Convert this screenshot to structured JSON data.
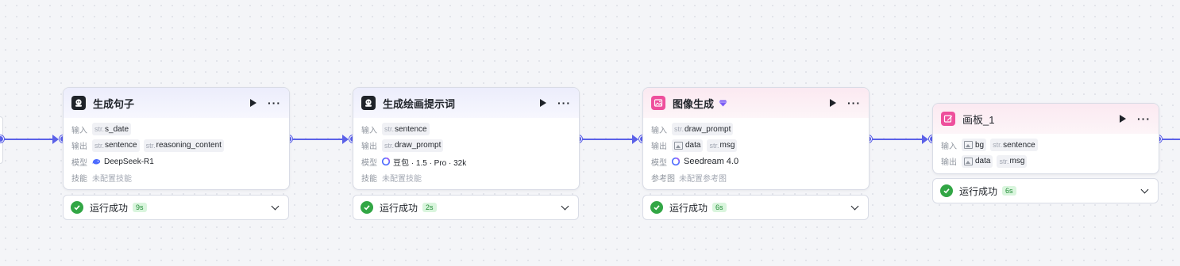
{
  "labels": {
    "input": "输入",
    "output": "输出",
    "model": "模型",
    "skill": "技能",
    "ref_image": "参考图",
    "str_type": "str.",
    "status_success": "运行成功"
  },
  "nodes": [
    {
      "title": "生成句子",
      "inputs": [
        "s_date"
      ],
      "outputs": [
        "sentence",
        "reasoning_content"
      ],
      "model": "DeepSeek-R1",
      "skill": "未配置技能",
      "run_time": "9s"
    },
    {
      "title": "生成绘画提示词",
      "inputs": [
        "sentence"
      ],
      "outputs": [
        "draw_prompt"
      ],
      "model": "豆包 · 1.5 · Pro · 32k",
      "skill": "未配置技能",
      "run_time": "2s"
    },
    {
      "title": "图像生成",
      "inputs": [
        "draw_prompt"
      ],
      "outputs": [
        "data",
        "msg"
      ],
      "model": "Seedream 4.0",
      "ref_image": "未配置参考图",
      "run_time": "6s"
    },
    {
      "title": "画板_1",
      "inputs": [
        "bg",
        "sentence"
      ],
      "outputs": [
        "data",
        "msg"
      ],
      "run_time": "6s"
    }
  ],
  "colors": {
    "edge": "#5b61e8",
    "success": "#32a645",
    "image_node_accent": "#ee4f9c"
  },
  "icons": {
    "llm_node": "robot-icon",
    "image_node": "image-icon",
    "canvas_node": "canvas-pen-icon",
    "run": "play-icon",
    "more": "more-dots-icon",
    "expand": "chevron-down-icon",
    "status": "check-circle-icon"
  }
}
